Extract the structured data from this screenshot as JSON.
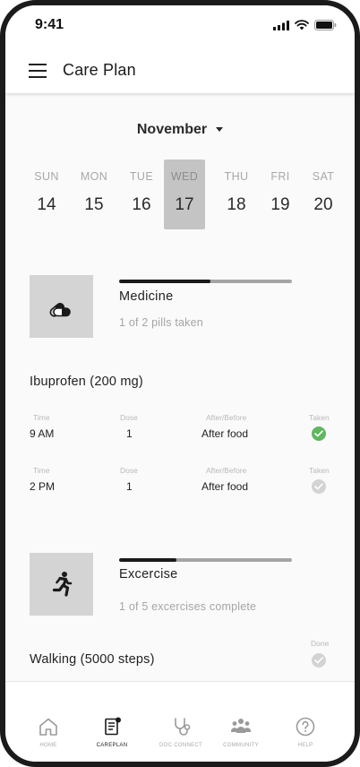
{
  "status_bar": {
    "time": "9:41"
  },
  "app_bar": {
    "title": "Care Plan"
  },
  "calendar": {
    "month": "November",
    "days": [
      {
        "dow": "SUN",
        "num": "14"
      },
      {
        "dow": "MON",
        "num": "15"
      },
      {
        "dow": "TUE",
        "num": "16"
      },
      {
        "dow": "WED",
        "num": "17",
        "selected": true
      },
      {
        "dow": "THU",
        "num": "18"
      },
      {
        "dow": "FRI",
        "num": "19"
      },
      {
        "dow": "SAT",
        "num": "20"
      }
    ]
  },
  "medicine": {
    "title": "Medicine",
    "subtitle": "1 of 2 pills taken",
    "progress": 0.53,
    "icon": "pills-icon",
    "item_name": "Ibuprofen (200 mg)",
    "columns": {
      "time": "Time",
      "dose": "Dose",
      "after": "After/Before",
      "taken": "Taken"
    },
    "doses": [
      {
        "time": "9 AM",
        "dose": "1",
        "after": "After food",
        "taken": true
      },
      {
        "time": "2 PM",
        "dose": "1",
        "after": "After food",
        "taken": false
      }
    ]
  },
  "exercise": {
    "title": "Excercise",
    "subtitle": "1 of 5 excercises complete",
    "progress": 0.33,
    "icon": "running-icon",
    "done_label": "Done",
    "items": [
      {
        "name": "Walking (5000 steps)",
        "done": false
      }
    ]
  },
  "bottom_nav": {
    "items": [
      {
        "label": "HOME",
        "icon": "home-icon"
      },
      {
        "label": "CAREPLAN",
        "icon": "careplan-icon",
        "active": true
      },
      {
        "label": "DOC CONNECT",
        "icon": "stethoscope-icon"
      },
      {
        "label": "COMMUNITY",
        "icon": "community-icon"
      },
      {
        "label": "HELP",
        "icon": "help-icon"
      }
    ]
  },
  "colors": {
    "accent_done": "#5fb760",
    "pending": "#d3d3d3",
    "tile": "#d4d4d4"
  }
}
